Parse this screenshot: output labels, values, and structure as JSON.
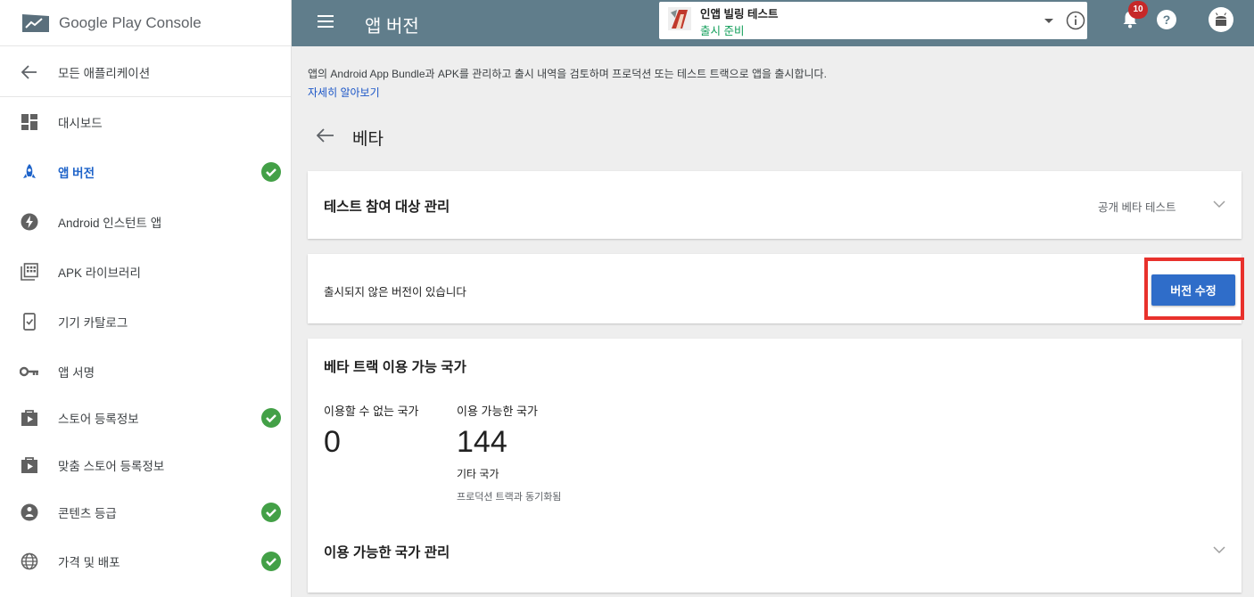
{
  "brand": {
    "google": "Google Play",
    "console": " Console"
  },
  "sidebar": {
    "back_label": "모든 애플리케이션",
    "items": [
      {
        "label": "대시보드",
        "icon": "dashboard-icon",
        "checked": false,
        "active": false
      },
      {
        "label": "앱 버전",
        "icon": "rocket-icon",
        "checked": true,
        "active": true
      },
      {
        "label": "Android 인스턴트 앱",
        "icon": "bolt-icon",
        "checked": false,
        "active": false
      },
      {
        "label": "APK 라이브러리",
        "icon": "library-icon",
        "checked": false,
        "active": false
      },
      {
        "label": "기기 카탈로그",
        "icon": "device-icon",
        "checked": false,
        "active": false
      },
      {
        "label": "앱 서명",
        "icon": "key-icon",
        "checked": false,
        "active": false
      },
      {
        "label": "스토어 등록정보",
        "icon": "store-icon",
        "checked": true,
        "active": false
      },
      {
        "label": "맞춤 스토어 등록정보",
        "icon": "store-icon",
        "checked": false,
        "active": false
      },
      {
        "label": "콘텐츠 등급",
        "icon": "rating-icon",
        "checked": true,
        "active": false
      },
      {
        "label": "가격 및 배포",
        "icon": "globe-icon",
        "checked": true,
        "active": false
      }
    ]
  },
  "topbar": {
    "title": "앱 버전",
    "app_name": "인앱 빌링 테스트",
    "app_status": "출시 준비",
    "notification_count": "10"
  },
  "main": {
    "description": "앱의 Android App Bundle과 APK를 관리하고 출시 내역을 검토하며 프로덕션 또는 테스트 트랙으로 앱을 출시합니다.",
    "learn_more": "자세히 알아보기",
    "section_title": "베타",
    "audience": {
      "title": "테스트 참여 대상 관리",
      "value": "공개 베타 테스트"
    },
    "draft": {
      "text": "출시되지 않은 버전이 있습니다",
      "button": "버전 수정"
    },
    "countries": {
      "title": "베타 트랙 이용 가능 국가",
      "unavailable_label": "이용할 수 없는 국가",
      "unavailable_value": "0",
      "available_label": "이용 가능한 국가",
      "available_value": "144",
      "other_label": "기타 국가",
      "sync_label": "프로덕션 트랙과 동기화됨",
      "manage_label": "이용 가능한 국가 관리"
    }
  },
  "colors": {
    "topbar": "#607d8b",
    "accent": "#2f6dc9",
    "check": "#43a047",
    "highlight": "#e8312c",
    "status_green": "#0f9d58"
  }
}
